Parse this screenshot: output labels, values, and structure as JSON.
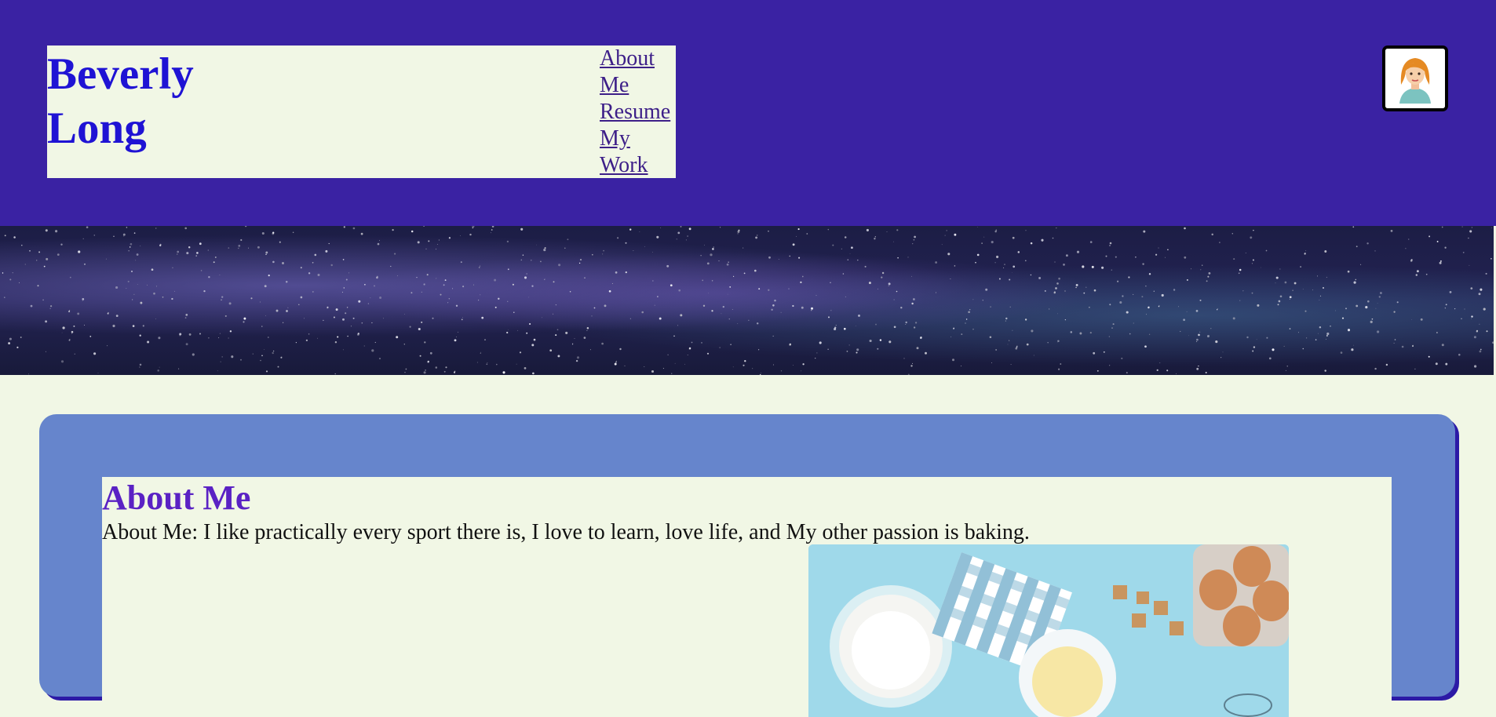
{
  "header": {
    "site_title": "Beverly Long",
    "nav": [
      {
        "label": "About Me"
      },
      {
        "label": "Resume"
      },
      {
        "label": "My Work"
      }
    ],
    "avatar_icon": "woman-avatar-icon",
    "background_color": "#3a22a3"
  },
  "banner": {
    "image": "starry-night-sky"
  },
  "main": {
    "about": {
      "heading": "About Me",
      "text": "About Me: I like practically every sport there is, I love to learn, love life, and My other passion is baking.",
      "image": "baking-ingredients-photo"
    },
    "card_color": "#6685cc",
    "heading_color": "#5a22c4"
  }
}
